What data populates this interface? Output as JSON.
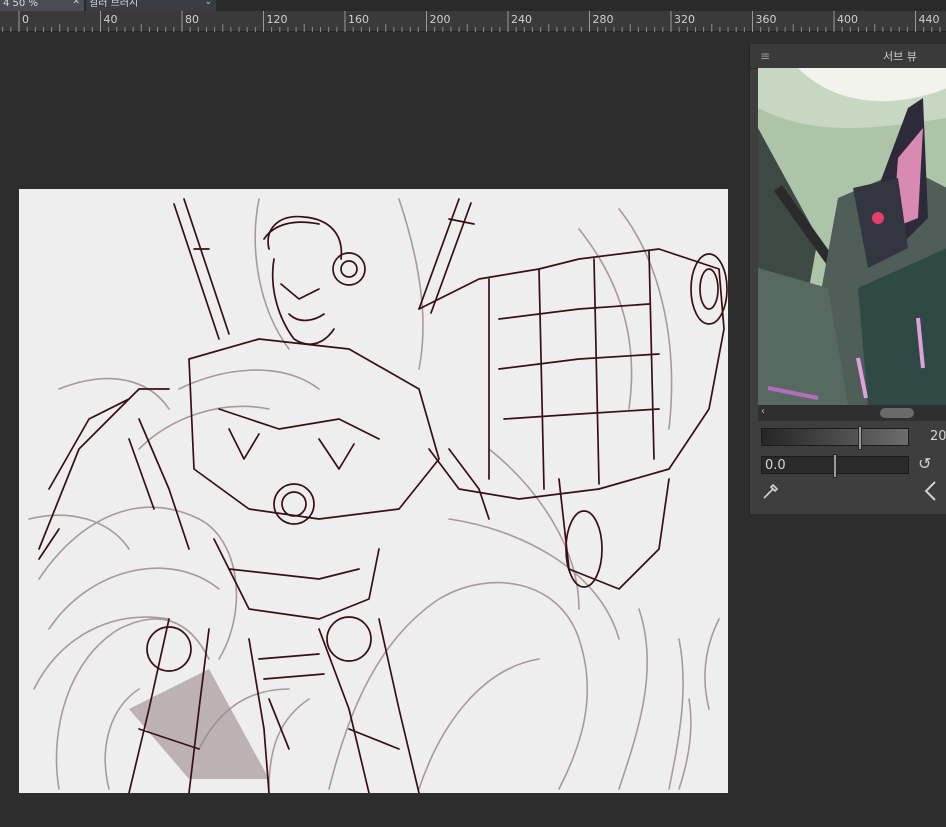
{
  "tabs": [
    {
      "label": "4 50 %",
      "active": true
    },
    {
      "label": "컬러 브러시",
      "active": false
    }
  ],
  "ruler": {
    "labels": [
      "0",
      "40",
      "80",
      "120",
      "160",
      "200",
      "240",
      "280",
      "320",
      "360",
      "400",
      "440"
    ]
  },
  "subview": {
    "title": "서브 뷰",
    "zoom_value": "20",
    "rotation_value": "0.0"
  },
  "colors": {
    "ink": "#3a0f14",
    "sketch": "#a9999b",
    "shade": "#9b8a8c",
    "paper": "#eeeeee"
  }
}
